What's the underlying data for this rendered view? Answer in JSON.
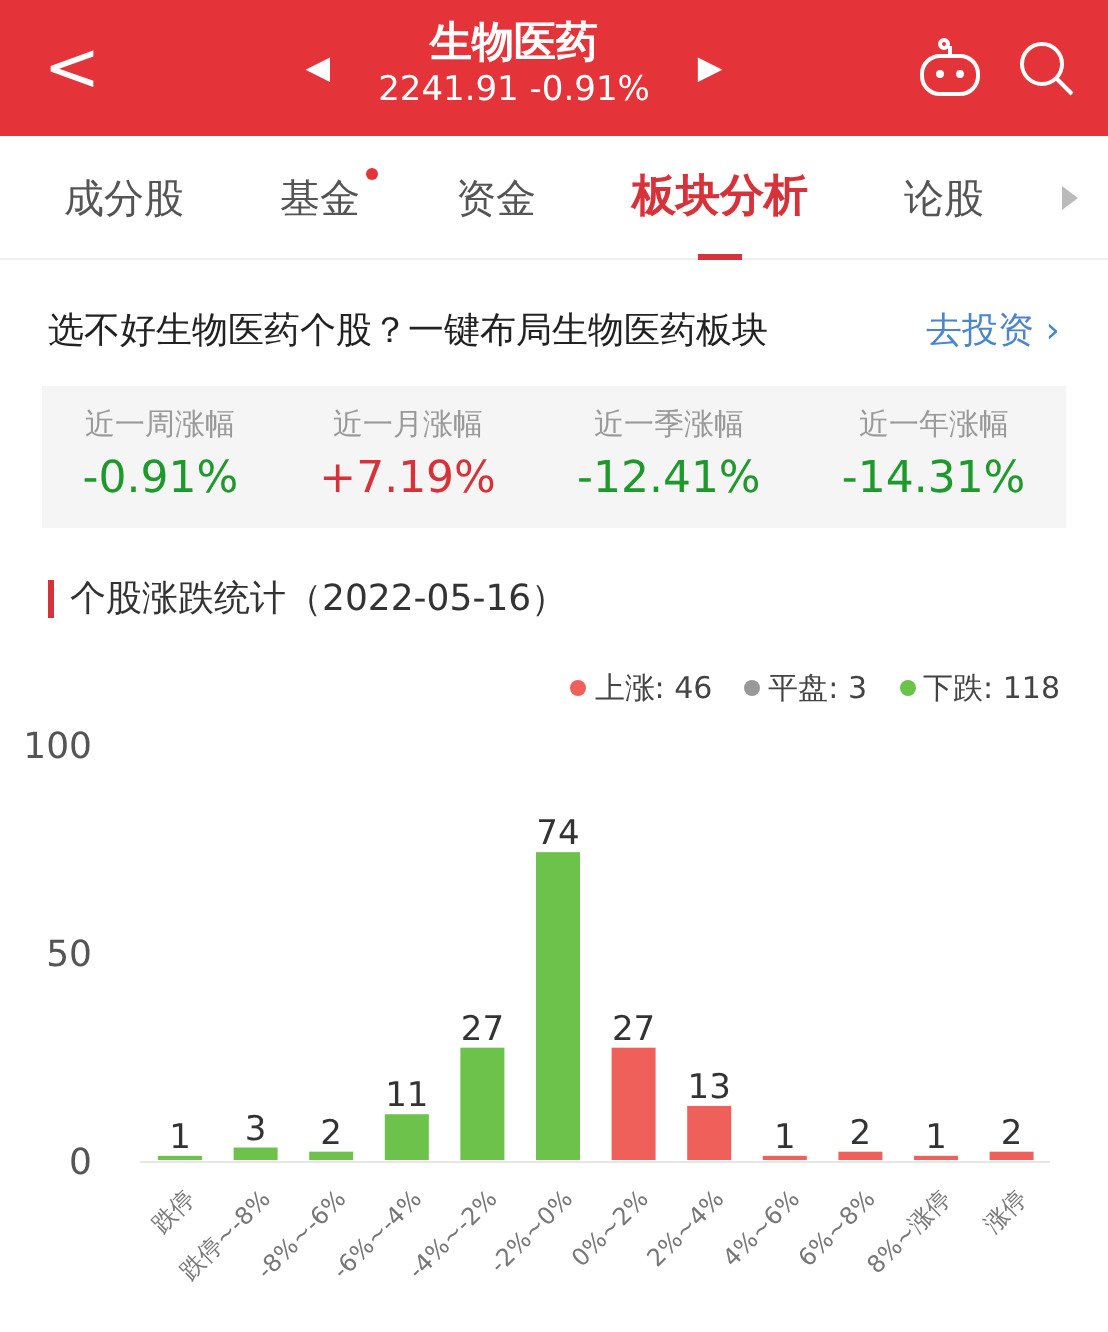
{
  "header": {
    "back": "<",
    "title": "生物医药",
    "prev": "◀",
    "next": "▶",
    "price": "2241.91",
    "change": "-0.91%"
  },
  "tabs": [
    {
      "label": "成分股",
      "selected": false,
      "dot": false
    },
    {
      "label": "基金",
      "selected": false,
      "dot": true
    },
    {
      "label": "资金",
      "selected": false,
      "dot": false
    },
    {
      "label": "板块分析",
      "selected": true,
      "dot": false
    },
    {
      "label": "论股",
      "selected": false,
      "dot": false
    }
  ],
  "promo": {
    "text": "选不好生物医药个股？一键布局生物医药板块",
    "link": "去投资 ›"
  },
  "stats": [
    {
      "label": "近一周涨幅",
      "value": "-0.91%",
      "color": "#1e9a2c"
    },
    {
      "label": "近一月涨幅",
      "value": "+7.19%",
      "color": "#d7323a"
    },
    {
      "label": "近一季涨幅",
      "value": "-12.41%",
      "color": "#1e9a2c"
    },
    {
      "label": "近一年涨幅",
      "value": "-14.31%",
      "color": "#1e9a2c"
    }
  ],
  "section_title": "个股涨跌统计（2022-05-16）",
  "legend": [
    {
      "label": "上涨: 46",
      "color": "#f0605a"
    },
    {
      "label": "平盘: 3",
      "color": "#999999"
    },
    {
      "label": "下跌: 118",
      "color": "#6cc24a"
    }
  ],
  "chart_data": {
    "type": "bar",
    "stacked": true,
    "data_labels": true,
    "ylim": [
      0,
      100
    ],
    "yticks": [
      0,
      50,
      100
    ],
    "categories": [
      "跌停",
      "跌停~-8%",
      "-8%~-6%",
      "-6%~-4%",
      "-4%~-2%",
      "-2%~0%",
      "0%~2%",
      "2%~4%",
      "4%~6%",
      "6%~8%",
      "8%~涨停",
      "涨停"
    ],
    "series": [
      {
        "color": "#6cc24a",
        "values": [
          1,
          3,
          2,
          11,
          27,
          74,
          null,
          null,
          null,
          null,
          null,
          null
        ]
      },
      {
        "color": "#f0605a",
        "values": [
          null,
          null,
          null,
          null,
          null,
          null,
          27,
          13,
          1,
          2,
          1,
          2
        ]
      }
    ]
  }
}
